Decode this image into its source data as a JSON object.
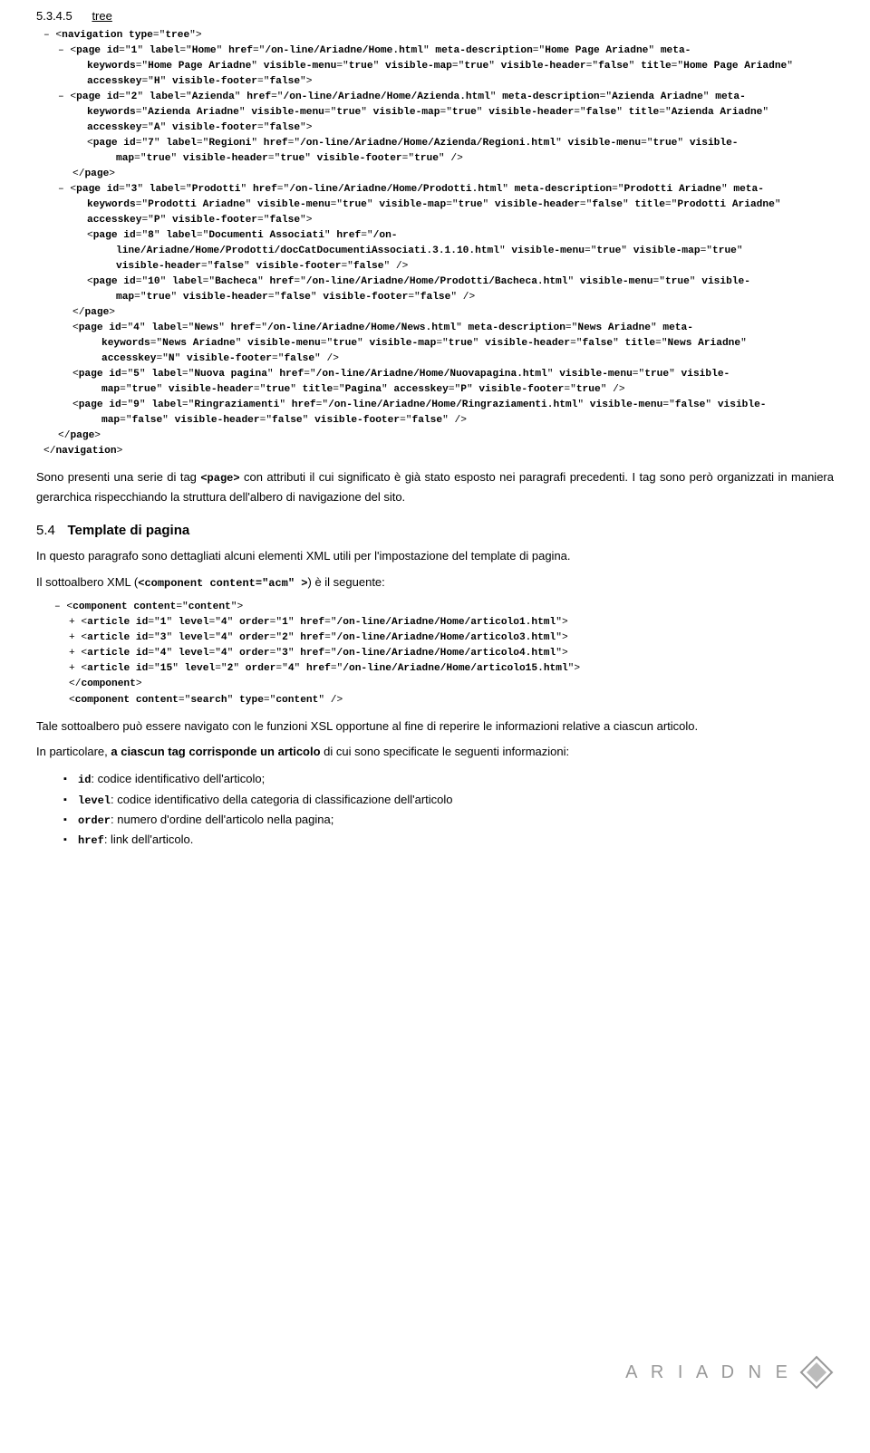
{
  "header": {
    "section_num": "5.3.4.5",
    "section_title": "tree"
  },
  "navigation_xml": {
    "lines": [
      "– <navigation type=\"tree\">",
      "   – <page id=\"1\" label=\"Home\" href=\"/on-line/Ariadne/Home.html\" meta-description=\"Home Page Ariadne\" meta-",
      "        keywords=\"Home Page Ariadne\" visible-menu=\"true\" visible-map=\"true\" visible-header=\"false\" title=\"Home Page Ariadne\"",
      "        accesskey=\"H\" visible-footer=\"false\">",
      "   – <page id=\"2\" label=\"Azienda\" href=\"/on-line/Ariadne/Home/Azienda.html\" meta-description=\"Azienda Ariadne\" meta-",
      "        keywords=\"Azienda Ariadne\" visible-menu=\"true\" visible-map=\"true\" visible-header=\"false\" title=\"Azienda Ariadne\"",
      "        accesskey=\"A\" visible-footer=\"false\">",
      "        <page id=\"7\" label=\"Regioni\" href=\"/on-line/Ariadne/Home/Azienda/Regioni.html\" visible-menu=\"true\" visible-",
      "             map=\"true\" visible-header=\"true\" visible-footer=\"true\" />",
      "     </page>",
      "   – <page id=\"3\" label=\"Prodotti\" href=\"/on-line/Ariadne/Home/Prodotti.html\" meta-description=\"Prodotti Ariadne\" meta-",
      "        keywords=\"Prodotti Ariadne\" visible-menu=\"true\" visible-map=\"true\" visible-header=\"false\" title=\"Prodotti Ariadne\"",
      "        accesskey=\"P\" visible-footer=\"false\">",
      "        <page id=\"8\" label=\"Documenti Associati\" href=\"/on-",
      "             line/Ariadne/Home/Prodotti/docCatDocumentiAssociati.3.1.10.html\" visible-menu=\"true\" visible-map=\"true\"",
      "             visible-header=\"false\" visible-footer=\"false\" />",
      "        <page id=\"10\" label=\"Bacheca\" href=\"/on-line/Ariadne/Home/Prodotti/Bacheca.html\" visible-menu=\"true\" visible-",
      "             map=\"true\" visible-header=\"false\" visible-footer=\"false\" />",
      "     </page>",
      "     <page id=\"4\" label=\"News\" href=\"/on-line/Ariadne/Home/News.html\" meta-description=\"News Ariadne\" meta-",
      "          keywords=\"News Ariadne\" visible-menu=\"true\" visible-map=\"true\" visible-header=\"false\" title=\"News Ariadne\"",
      "          accesskey=\"N\" visible-footer=\"false\" />",
      "     <page id=\"5\" label=\"Nuova pagina\" href=\"/on-line/Ariadne/Home/Nuovapagina.html\" visible-menu=\"true\" visible-",
      "          map=\"true\" visible-header=\"true\" title=\"Pagina\" accesskey=\"P\" visible-footer=\"true\" />",
      "     <page id=\"9\" label=\"Ringraziamenti\" href=\"/on-line/Ariadne/Home/Ringraziamenti.html\" visible-menu=\"false\" visible-",
      "          map=\"false\" visible-header=\"false\" visible-footer=\"false\" />",
      "   </page>",
      "</navigation>"
    ]
  },
  "paragraph_after_nav": "Sono presenti una serie di tag <page> con attributi il cui significato è già stato esposto nei paragrafi precedenti. I tag sono però organizzati in maniera gerarchica rispecchiando la struttura dell'albero di navigazione del sito.",
  "section_5_4": {
    "num": "5.4",
    "title": "Template di pagina",
    "intro1": "In questo paragrafo sono dettagliati alcuni elementi XML utili per l'impostazione del template di pagina.",
    "intro2_prefix": "Il sottoalbero XML (",
    "intro2_code": "<component content=\"acm\" >",
    "intro2_suffix": ") è il seguente:"
  },
  "component_xml": {
    "lines": [
      "– <component content=\"content\">",
      "  + <article id=\"1\" level=\"4\" order=\"1\" href=\"/on-line/Ariadne/Home/articolo1.html\">",
      "  + <article id=\"3\" level=\"4\" order=\"2\" href=\"/on-line/Ariadne/Home/articolo3.html\">",
      "  + <article id=\"4\" level=\"4\" order=\"3\" href=\"/on-line/Ariadne/Home/articolo4.html\">",
      "  + <article id=\"15\" level=\"2\" order=\"4\" href=\"/on-line/Ariadne/Home/articolo15.html\">",
      "  </component>",
      "  <component content=\"search\" type=\"content\" />"
    ]
  },
  "paragraph_tale": "Tale sottoalbero può essere navigato con le funzioni XSL opportune al fine di reperire le informazioni relative a ciascun articolo.",
  "paragraph_particolare": "In particolare, a ciascun tag corrisponde un articolo di cui sono specificate le seguenti informazioni:",
  "bullet_items": [
    {
      "term": "id",
      "desc": ": codice identificativo dell'articolo;"
    },
    {
      "term": "level",
      "desc": ": codice identificativo della categoria di classificazione dell'articolo"
    },
    {
      "term": "order",
      "desc": ": numero d'ordine dell'articolo nella pagina;"
    },
    {
      "term": "href",
      "desc": ": link dell'articolo."
    }
  ],
  "logo": {
    "text": "A R I A D N E"
  }
}
